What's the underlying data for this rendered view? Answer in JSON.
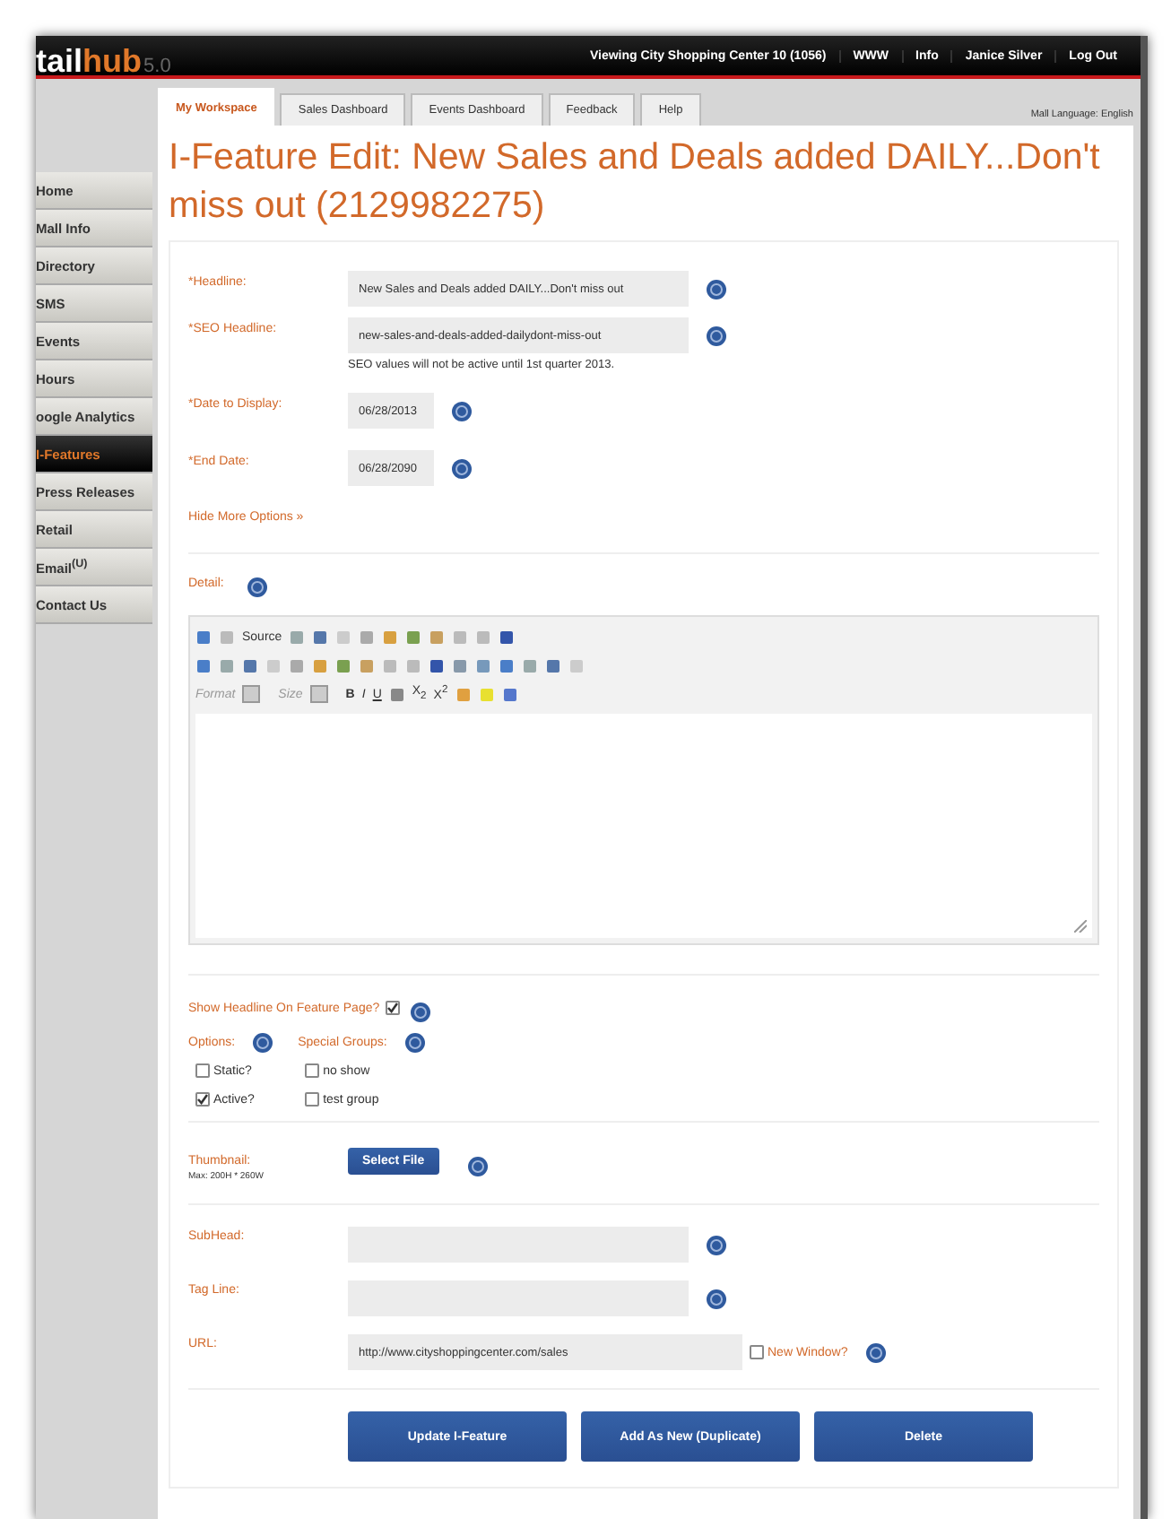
{
  "header": {
    "logo_main": "tail",
    "logo_accent": "hub",
    "version": "5.0",
    "links": [
      "Viewing City Shopping Center 10 (1056)",
      "WWW",
      "Info",
      "Janice Silver",
      "Log Out"
    ]
  },
  "tabs": [
    {
      "label": "My Workspace",
      "selected": true
    },
    {
      "label": "Sales Dashboard",
      "selected": false
    },
    {
      "label": "Events Dashboard",
      "selected": false
    },
    {
      "label": "Feedback",
      "selected": false
    },
    {
      "label": "Help",
      "selected": false
    }
  ],
  "language": "Mall Language: English",
  "sidebar": {
    "items": [
      {
        "label": "Home",
        "selected": false
      },
      {
        "label": "Mall Info",
        "selected": false
      },
      {
        "label": "Directory",
        "selected": false
      },
      {
        "label": "SMS",
        "selected": false
      },
      {
        "label": "Events",
        "selected": false
      },
      {
        "label": "Hours",
        "selected": false
      },
      {
        "label": "oogle Analytics",
        "selected": false
      },
      {
        "label": "I-Features",
        "selected": true
      },
      {
        "label": "Press Releases",
        "selected": false
      },
      {
        "label": "Retail",
        "selected": false
      },
      {
        "label": "Email$^{(U)}$",
        "selected": false
      },
      {
        "label": "Contact Us",
        "selected": false
      }
    ]
  },
  "title": "I-Feature Edit: New Sales and Deals added DAILY...Don't miss out (2129982275)",
  "fields": [
    {
      "kind": "text",
      "label": "*Headline:",
      "value": "New Sales and Deals added DAILY...Don't miss out"
    },
    {
      "kind": "text",
      "label": "*SEO Headline:",
      "value": "new-sales-and-deals-added-dailydont-miss-out",
      "note": "SEO values will not be active until 1st quarter 2013."
    },
    {
      "kind": "date",
      "label": "*Date to Display:",
      "value": "06/28/2013"
    },
    {
      "kind": "date",
      "label": "*End Date:",
      "value": "06/28/2090"
    }
  ],
  "more_options_link": "Hide More Options »",
  "detail": {
    "label": "Detail:",
    "toolbar": {
      "source": "Source",
      "format": "Format",
      "size": "Size",
      "bold": "B",
      "italic": "I",
      "underline": "U",
      "subscript": "X$_{2}$",
      "superscript": "X$^{2}$"
    }
  },
  "show_headline": {
    "label": "Show Headline On Feature Page?",
    "checked": true
  },
  "options": {
    "label": "Options:",
    "items": [
      {
        "label": "Static?",
        "checked": false
      },
      {
        "label": "Active?",
        "checked": true
      }
    ]
  },
  "special_groups": {
    "label": "Special Groups:",
    "items": [
      {
        "label": "no show",
        "checked": false
      },
      {
        "label": "test group",
        "checked": false
      }
    ]
  },
  "thumbnail": {
    "label": "Thumbnail:",
    "note": "Max: 200H * 260W",
    "button": "Select File"
  },
  "more_fields": [
    {
      "label": "SubHead:"
    },
    {
      "label": "Tag Line:"
    },
    {
      "label": "URL:",
      "value": "http://www.cityshoppingcenter.com/sales",
      "new_window": {
        "label": "New Window?",
        "checked": false
      }
    }
  ],
  "buttons": [
    "Update I-Feature",
    "Add As New (Duplicate)",
    "Delete"
  ]
}
